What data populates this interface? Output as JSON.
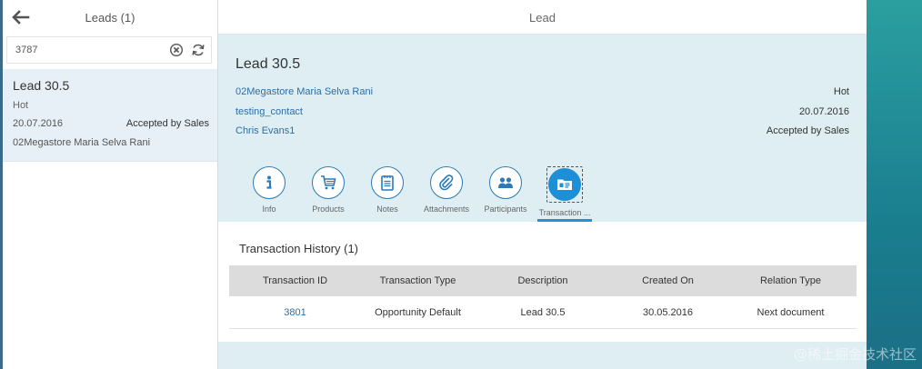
{
  "master": {
    "title": "Leads (1)",
    "search_value": "3787",
    "item": {
      "title": "Lead 30.5",
      "priority": "Hot",
      "date": "20.07.2016",
      "status": "Accepted by Sales",
      "account": "02Megastore Maria Selva Rani"
    }
  },
  "detail": {
    "header_title": "Lead",
    "object_title": "Lead 30.5",
    "links": [
      "02Megastore Maria Selva Rani",
      "testing_contact",
      "Chris Evans1"
    ],
    "attributes": [
      "Hot",
      "20.07.2016",
      "Accepted by Sales"
    ],
    "tabs": [
      {
        "label": "Info",
        "icon": "info-icon"
      },
      {
        "label": "Products",
        "icon": "cart-icon"
      },
      {
        "label": "Notes",
        "icon": "notes-icon"
      },
      {
        "label": "Attachments",
        "icon": "paperclip-icon"
      },
      {
        "label": "Participants",
        "icon": "people-icon"
      },
      {
        "label": "Transaction ...",
        "icon": "transaction-icon"
      }
    ],
    "section_title": "Transaction History (1)",
    "table": {
      "columns": [
        "Transaction ID",
        "Transaction Type",
        "Description",
        "Created On",
        "Relation Type"
      ],
      "rows": [
        [
          "3801",
          "Opportunity Default",
          "Lead 30.5",
          "30.05.2016",
          "Next document"
        ]
      ]
    }
  },
  "watermark": "@稀土掘金技术社区",
  "colors": {
    "accent": "#1d8fd6",
    "header_bg": "#deeef3",
    "selected_bg": "#e6f0f6",
    "link": "#2a6fa8"
  }
}
